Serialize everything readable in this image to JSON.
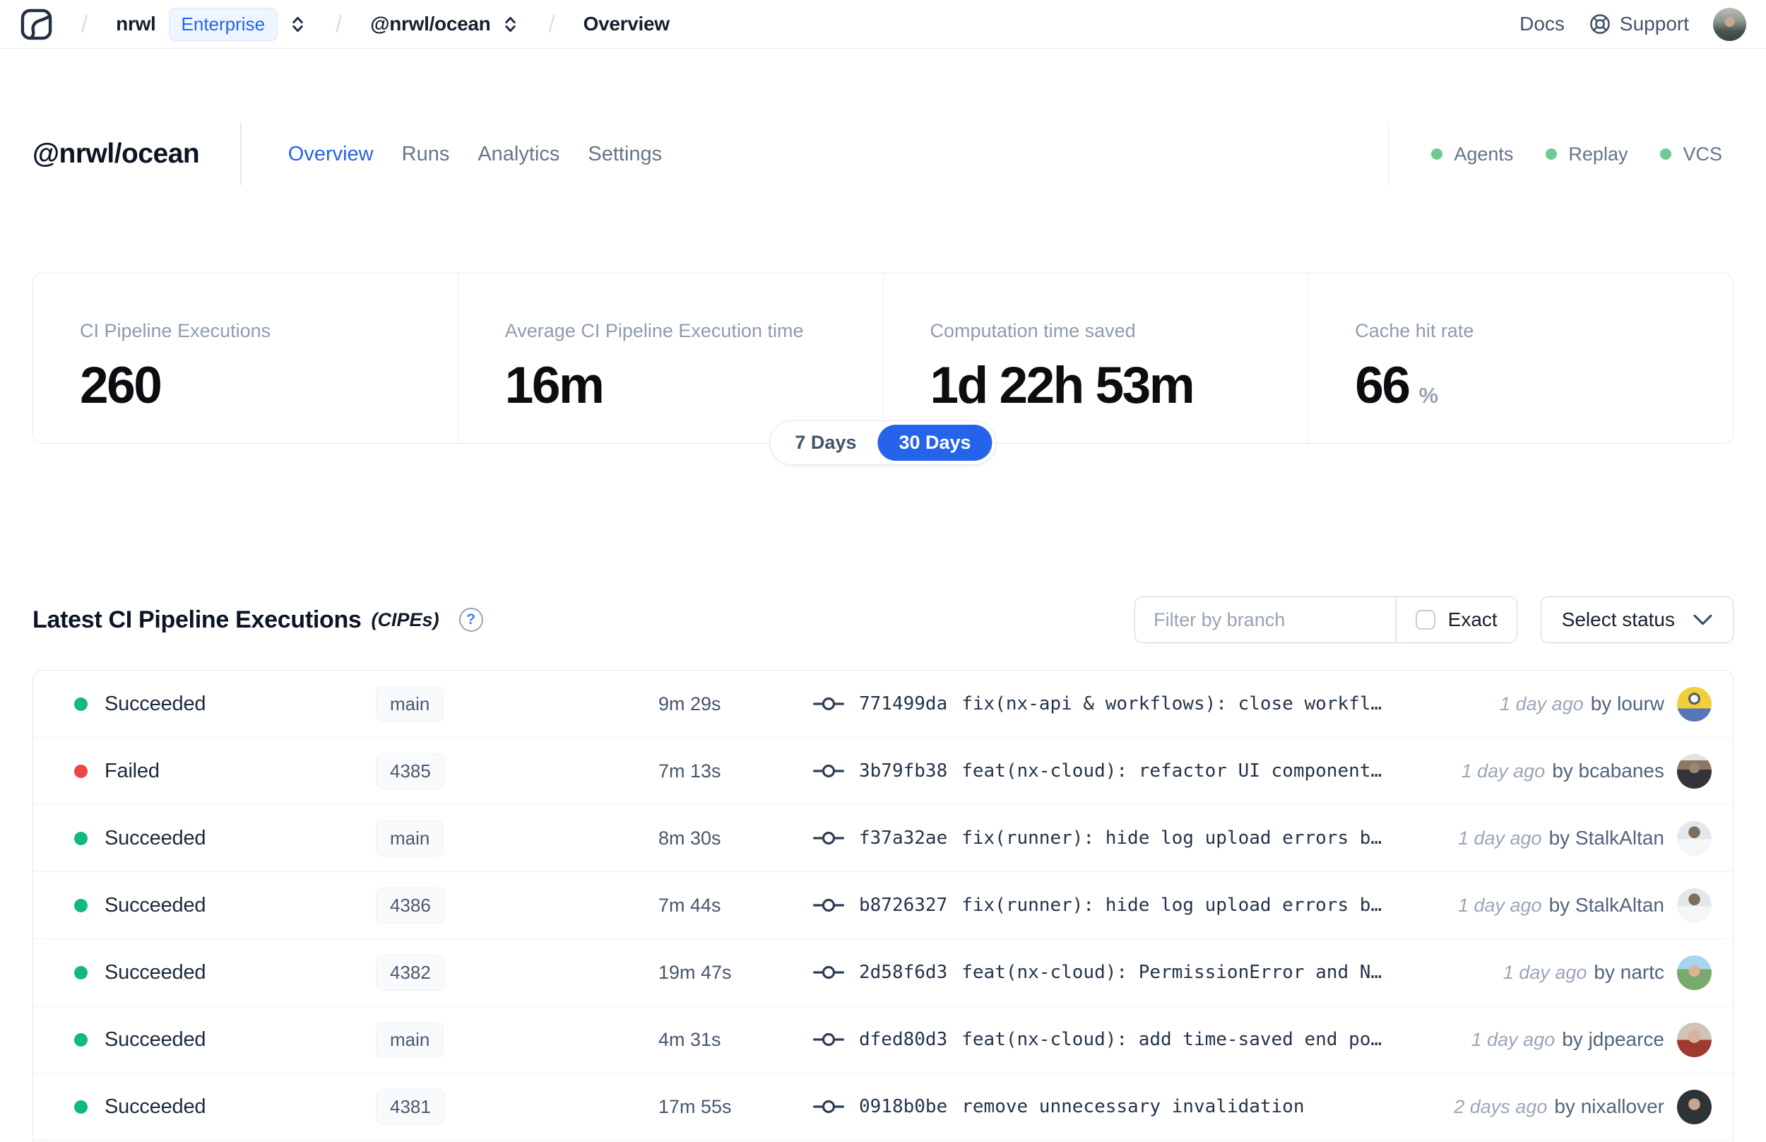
{
  "colors": {
    "accent": "#2563eb",
    "succeeded": "#10b981",
    "failed": "#ef4444",
    "feature_dot": "#6fca92"
  },
  "navbar": {
    "org": "nrwl",
    "plan_badge": "Enterprise",
    "workspace": "@nrwl/ocean",
    "page": "Overview",
    "docs_label": "Docs",
    "support_label": "Support",
    "avatar_bg": "radial-gradient(circle at 50% 42%, #c6a78f 0 20%, rgba(0,0,0,0) 20%), linear-gradient(180deg,#b9c0b6 0%,#8d988e 40%,#4a554d 70%,#39453f 100%)"
  },
  "header": {
    "title": "@nrwl/ocean",
    "tabs": [
      {
        "label": "Overview",
        "active": true
      },
      {
        "label": "Runs",
        "active": false
      },
      {
        "label": "Analytics",
        "active": false
      },
      {
        "label": "Settings",
        "active": false
      }
    ],
    "features": [
      {
        "label": "Agents"
      },
      {
        "label": "Replay"
      },
      {
        "label": "VCS"
      }
    ]
  },
  "stats": {
    "period_7": "7 Days",
    "period_30": "30 Days",
    "cards": [
      {
        "label": "CI Pipeline Executions",
        "value": "260",
        "suffix": ""
      },
      {
        "label": "Average CI Pipeline Execution time",
        "value": "16m",
        "suffix": ""
      },
      {
        "label": "Computation time saved",
        "value": "1d 22h 53m",
        "suffix": ""
      },
      {
        "label": "Cache hit rate",
        "value": "66",
        "suffix": "%"
      }
    ]
  },
  "section": {
    "title": "Latest CI Pipeline Executions",
    "subtitle": "(CIPEs)",
    "help": "?",
    "filter_placeholder": "Filter by branch",
    "exact_label": "Exact",
    "select_status_label": "Select status"
  },
  "table": {
    "rows": [
      {
        "status": "Succeeded",
        "branch": "main",
        "duration": "9m 29s",
        "commit_hash": "771499da",
        "commit_message": "fix(nx-api & workflows): close workfl…",
        "time_ago": "1 day ago",
        "author": "by lourw",
        "avatar_bg": "radial-gradient(circle at 50% 34%, #f4f6f7 0 13%, #5b5f66 13% 21%, rgba(0,0,0,0) 21%), linear-gradient(180deg,#f0cf3a 0 62%,#5577b8 62%)"
      },
      {
        "status": "Failed",
        "branch": "4385",
        "duration": "7m 13s",
        "commit_hash": "3b79fb38",
        "commit_message": "feat(nx-cloud): refactor UI component…",
        "time_ago": "1 day ago",
        "author": "by bcabanes",
        "avatar_bg": "radial-gradient(circle at 50% 40%, #9a8672 0 20%, rgba(0,0,0,0) 20%), linear-gradient(180deg,#e4e2de 0 18%,#8a7764 18% 45%,#33333b 45%)"
      },
      {
        "status": "Succeeded",
        "branch": "main",
        "duration": "8m 30s",
        "commit_hash": "f37a32ae",
        "commit_message": "fix(runner): hide log upload errors b…",
        "time_ago": "1 day ago",
        "author": "by StalkAltan",
        "avatar_bg": "radial-gradient(circle at 50% 32%, #7d6d5c 0 20%, rgba(0,0,0,0) 20%), linear-gradient(180deg,#e3e7ea 0 52%,#f5f6f7 52%)"
      },
      {
        "status": "Succeeded",
        "branch": "4386",
        "duration": "7m 44s",
        "commit_hash": "b8726327",
        "commit_message": "fix(runner): hide log upload errors b…",
        "time_ago": "1 day ago",
        "author": "by StalkAltan",
        "avatar_bg": "radial-gradient(circle at 50% 32%, #7d6d5c 0 20%, rgba(0,0,0,0) 20%), linear-gradient(180deg,#e3e7ea 0 52%,#f5f6f7 52%)"
      },
      {
        "status": "Succeeded",
        "branch": "4382",
        "duration": "19m 47s",
        "commit_hash": "2d58f6d3",
        "commit_message": "feat(nx-cloud): PermissionError and N…",
        "time_ago": "1 day ago",
        "author": "by nartc",
        "avatar_bg": "radial-gradient(circle at 50% 45%, #d9b48e 0 22%, rgba(0,0,0,0) 22%), linear-gradient(180deg,#a8d4ee 0 40%,#79a96b 40%)"
      },
      {
        "status": "Succeeded",
        "branch": "main",
        "duration": "4m 31s",
        "commit_hash": "dfed80d3",
        "commit_message": "feat(nx-cloud): add time-saved end po…",
        "time_ago": "1 day ago",
        "author": "by jdpearce",
        "avatar_bg": "radial-gradient(circle at 50% 40%, #d9b49b 0 24%, rgba(0,0,0,0) 24%), linear-gradient(180deg,#cfc4b6 0 50%,#9e3a30 50%)"
      },
      {
        "status": "Succeeded",
        "branch": "4381",
        "duration": "17m 55s",
        "commit_hash": "0918b0be",
        "commit_message": "remove unnecessary invalidation",
        "time_ago": "2 days ago",
        "author": "by nixallover",
        "avatar_bg": "radial-gradient(circle at 50% 42%, #caa58f 0 22%, rgba(0,0,0,0) 22%), linear-gradient(180deg,#2e3338 0 100%)"
      }
    ]
  }
}
